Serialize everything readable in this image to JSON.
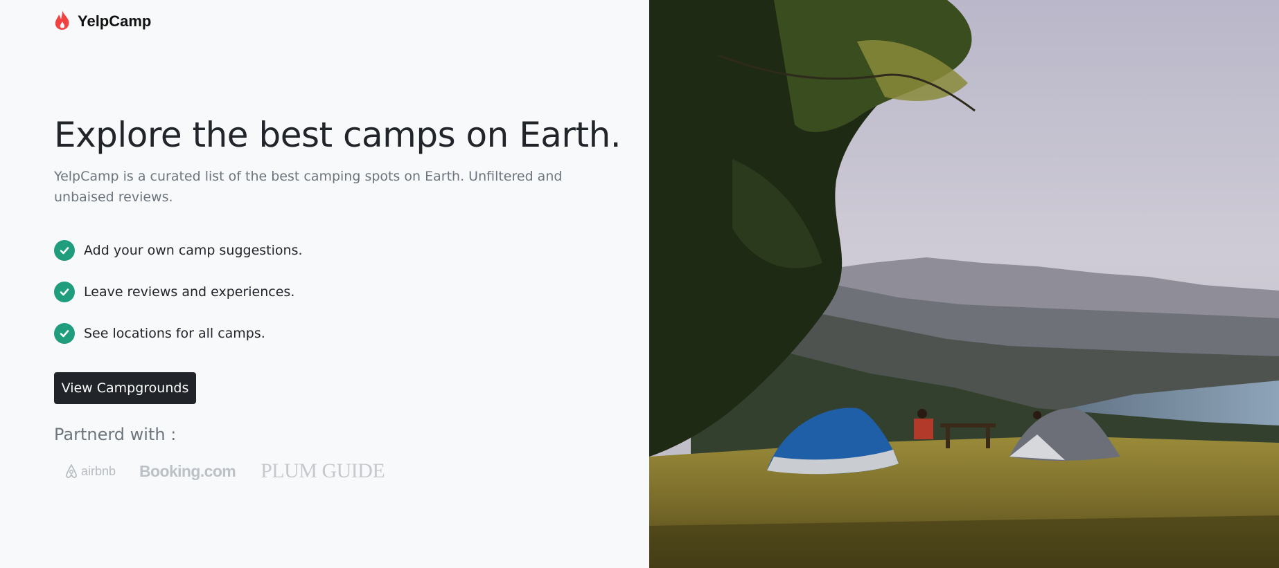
{
  "brand": {
    "name": "YelpCamp",
    "icon": "flame-icon",
    "color": "#f14141"
  },
  "hero": {
    "title": "Explore the best camps on Earth.",
    "subtitle": "YelpCamp is a curated list of the best camping spots on Earth. Unfiltered and unbaised reviews."
  },
  "features": [
    {
      "icon": "check-circle-icon",
      "text": "Add your own camp suggestions."
    },
    {
      "icon": "check-circle-icon",
      "text": "Leave reviews and experiences."
    },
    {
      "icon": "check-circle-icon",
      "text": "See locations for all camps."
    }
  ],
  "cta": {
    "label": "View Campgrounds"
  },
  "partners": {
    "title": "Partnerd with :",
    "logos": [
      {
        "name": "airbnb",
        "text": "airbnb"
      },
      {
        "name": "booking",
        "text": "Booking.com"
      },
      {
        "name": "plum-guide",
        "text": "PLUM GUIDE"
      }
    ]
  },
  "colors": {
    "accent_check": "#1f9d7d",
    "button": "#212529",
    "background": "#f8f9fa"
  }
}
